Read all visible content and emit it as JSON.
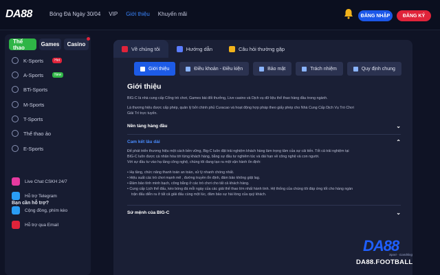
{
  "header": {
    "logo": "DA88",
    "nav": [
      "Bóng Đá Ngày 30/04",
      "VIP",
      "Giới thiệu",
      "Khuyến mãi"
    ],
    "active_nav": "Giới thiệu",
    "login_label": "ĐĂNG NHẬP",
    "register_label": "ĐĂNG KÝ"
  },
  "sidebar": {
    "tabs": [
      "Thể thao",
      "Games",
      "Casino"
    ],
    "items": [
      {
        "label": "K-Sports",
        "badge": "Hot",
        "badge_color": "#e0233a"
      },
      {
        "label": "A-Sports",
        "badge": "New",
        "badge_color": "#2fb546"
      },
      {
        "label": "BTi-Sports"
      },
      {
        "label": "M-Sports"
      },
      {
        "label": "T-Sports"
      },
      {
        "label": "Thể thao ảo"
      },
      {
        "label": "E-Sports"
      }
    ],
    "help_title": "Bạn cần hỗ trợ?",
    "help_items": [
      {
        "label": "Live Chat CSKH 24/7",
        "color": "#e63aa0"
      },
      {
        "label": "Hỗ trợ Telegram",
        "color": "#2a9df4"
      },
      {
        "label": "Cộng đồng, phím kèo",
        "color": "#2a9df4"
      },
      {
        "label": "Hỗ trợ qua Email",
        "color": "#e0233a"
      }
    ]
  },
  "main": {
    "tabs": [
      "Về chúng tôi",
      "Hướng dẫn",
      "Câu hỏi thường gặp"
    ],
    "subtabs": [
      "Giới thiệu",
      "Điều khoản - Điều kiện",
      "Bảo mật",
      "Trách nhiệm",
      "Quy định chung"
    ],
    "title": "Giới thiệu",
    "intro1": "BIG-C là nhà cung cấp Cổng trò chơi, Games bài đổi thưởng, Live casino và Dịch vụ dữ liệu thể thao hàng đầu trong ngành.",
    "intro2a": "Là thương hiệu được cấp phép, quản lý bởi chính phủ Curacao và hoạt động hợp pháp theo giấy phép cho Nhà Cung Cấp Dịch Vụ Trò Chơi",
    "intro2b": "Giải Trí trực tuyến.",
    "acc1": "Nền tảng hàng đầu",
    "acc2": "Cam kết lâu dài",
    "acc2_p1": "Để phát triển thương hiệu một cách bền vững, Big-C luôn đặt trải nghiệm khách hàng làm trọng tâm của sự cải tiến. Tốt cả trải nghiệm tại",
    "acc2_p2": "BIG-C luôn được cá nhân hóa tới từng khách hàng, bằng sự đầu tư nghiêm túc và dài hạn về công nghệ và con người.",
    "acc2_p3": "Với sự đầu tư vào hạ tầng công nghệ, chúng tôi đang tạo ra một vận hành ổn định:",
    "bullets": [
      "Hạ tầng, chức năng thanh toán an toàn, xử lý nhanh chóng nhất.",
      "Hiệu suất các trò chơi mạnh mẽ , đường truyền ổn định, đảm bảo không giật lag.",
      "Đảm bảo tính minh bạch, công bằng ở các trò chơi cho tất cả khách hàng.",
      "Cung cấp Lịch thể đấu, kèo bóng đá mỗi ngày của các giải thể thao lớn nhất hành tinh. Hệ thống của chúng tôi đáp ứng tốt cho hàng ngàn",
      "trận đấu diễn ra ở tất cả giải đấu cùng một lúc, đảm bảo sự hài lòng của quý khách."
    ],
    "acc3": "Sứ mệnh của BIG-C"
  },
  "brand": {
    "logo": "DA88",
    "tagline": "Sport - Gambling",
    "domain": "DA88.FOOTBALL"
  }
}
